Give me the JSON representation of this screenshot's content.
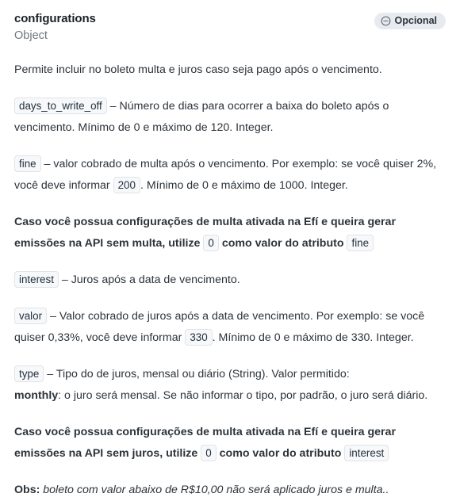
{
  "header": {
    "property_name": "configurations",
    "property_type": "Object",
    "badge_label": "Opcional",
    "badge_icon": "circle-minus-icon",
    "badge_bg_color": "#e7eaee",
    "badge_text_color": "#2c333a"
  },
  "intro": "Permite incluir no boleto multa e juros caso seja pago após o vencimento.",
  "fields": {
    "days_to_write_off": {
      "token": "days_to_write_off",
      "description": "– Número de dias para ocorrer a baixa do boleto após o vencimento. Mínimo de 0 e máximo de 120. Integer."
    },
    "fine": {
      "token": "fine",
      "text_before": "– valor cobrado de multa após o vencimento. Por exemplo: se você quiser 2%, você deve informar",
      "value_token": "200",
      "text_after": ". Mínimo de 0 e máximo de 1000. Integer."
    },
    "interest": {
      "token": "interest",
      "description": "– Juros após a data de vencimento."
    },
    "valor": {
      "token": "valor",
      "text_before": "– Valor cobrado de juros após a data de vencimento. Por exemplo: se você quiser 0,33%, você deve informar",
      "value_token": "330",
      "text_after": ". Mínimo de 0 e máximo de 330. Integer."
    },
    "type": {
      "token": "type",
      "description": "– Tipo do de juros, mensal ou diário (String). Valor permitido:",
      "value_bold": "monthly",
      "value_description": ": o juro será mensal. Se não informar o tipo, por padrão, o juro será diário."
    }
  },
  "notes": {
    "fine_note": {
      "text_before": "Caso você possua configurações de multa ativada na Efí e queira gerar emissões na API sem multa, utilize",
      "value_token": "0",
      "text_middle": "como valor do atributo",
      "attribute_token": "fine"
    },
    "interest_note": {
      "text_before": "Caso você possua configurações de multa ativada na Efí e queira gerar emissões na API sem juros, utilize",
      "value_token": "0",
      "text_middle": "como valor do atributo",
      "attribute_token": "interest"
    },
    "obs": {
      "label": "Obs:",
      "text": "boleto com valor abaixo de R$10,00 não será aplicado juros e multa.."
    }
  }
}
